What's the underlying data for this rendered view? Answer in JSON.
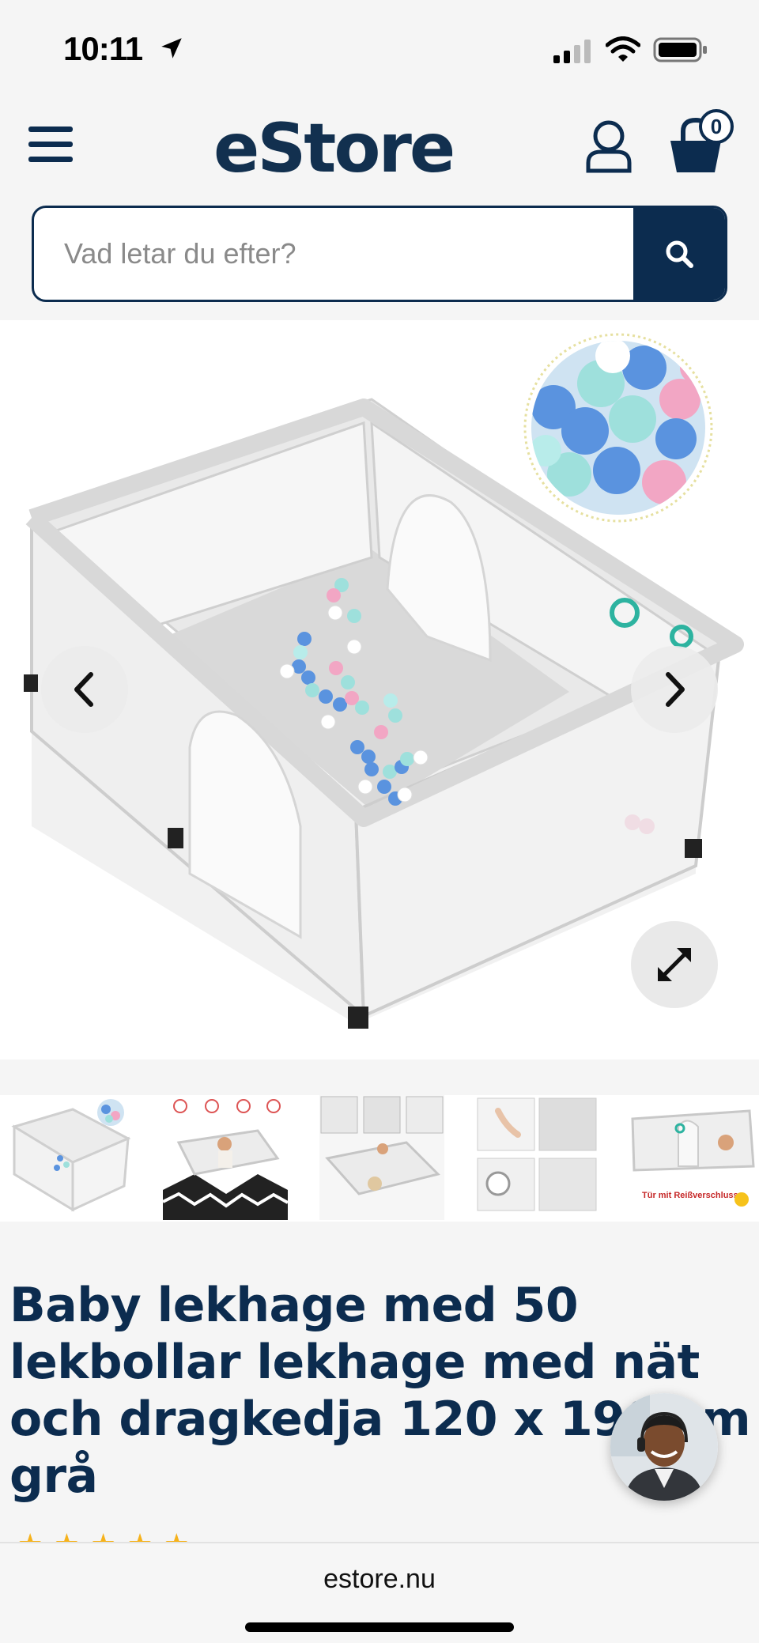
{
  "status_bar": {
    "time": "10:11"
  },
  "header": {
    "logo": "eStore",
    "cart_count": "0",
    "search": {
      "placeholder": "Vad letar du efter?"
    }
  },
  "product": {
    "title": "Baby lekhage med 50 lekbollar lekhage med nät och dragkedja 120 x 190 cm grå",
    "thumbnails": [
      {
        "name": "thumbnail-1"
      },
      {
        "name": "thumbnail-2"
      },
      {
        "name": "thumbnail-3"
      },
      {
        "name": "thumbnail-4"
      },
      {
        "name": "thumbnail-5",
        "caption": "Tür mit Reißverschluss"
      }
    ],
    "rating_stars": "★★★★★"
  },
  "browser": {
    "url": "estore.nu"
  },
  "colors": {
    "brand": "#0c2c4f",
    "accent_star": "#f6b21b"
  },
  "icons": [
    "menu-icon",
    "account-icon",
    "cart-icon",
    "search-icon",
    "chevron-left-icon",
    "chevron-right-icon",
    "expand-icon",
    "location-arrow-icon",
    "signal-icon",
    "wifi-icon",
    "battery-icon"
  ]
}
